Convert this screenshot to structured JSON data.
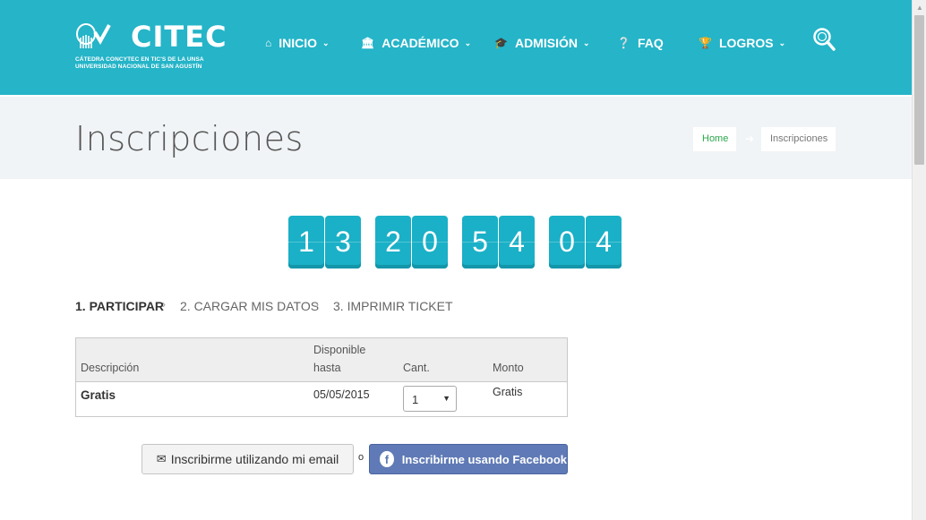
{
  "header": {
    "logo_text": "CITEC",
    "logo_subtitle_1": "CÁTEDRA CONCYTEC EN TIC'S DE LA UNSA",
    "logo_subtitle_2": "UNIVERSIDAD NACIONAL DE SAN AGUSTÍN",
    "background_color": "#25b4c8",
    "nav": [
      {
        "label": "INICIO",
        "icon": "home-icon",
        "dropdown": true
      },
      {
        "label": "ACADÉMICO",
        "icon": "institution-icon",
        "dropdown": true
      },
      {
        "label": "ADMISIÓN",
        "icon": "graduation-cap-icon",
        "dropdown": true
      },
      {
        "label": "FAQ",
        "icon": "question-circle-icon",
        "dropdown": false
      },
      {
        "label": "LOGROS",
        "icon": "trophy-icon",
        "dropdown": true
      }
    ],
    "search_icon": "search-icon"
  },
  "title_band": {
    "title": "Inscripciones",
    "breadcrumb": {
      "home": "Home",
      "current": "Inscripciones"
    }
  },
  "countdown": {
    "digits": [
      "1",
      "3",
      "2",
      "0",
      "5",
      "4",
      "0",
      "4"
    ],
    "color": "#1ab0c7"
  },
  "steps": [
    {
      "label": "1. PARTICIPAR",
      "active": true
    },
    {
      "label": "2. CARGAR MIS DATOS",
      "active": false
    },
    {
      "label": "3. IMPRIMIR TICKET",
      "active": false
    }
  ],
  "table": {
    "headers": {
      "description": "Descripción",
      "available_line1": "Disponible",
      "available_line2": "hasta",
      "quantity": "Cant.",
      "amount": "Monto"
    },
    "rows": [
      {
        "description": "Gratis",
        "available_until": "05/05/2015",
        "quantity": "1",
        "amount": "Gratis"
      }
    ]
  },
  "actions": {
    "email_button": "Inscribirme utilizando mi email",
    "or_text": "o",
    "facebook_button": "Inscribirme usando Facebook",
    "facebook_color": "#5f7ab6"
  }
}
